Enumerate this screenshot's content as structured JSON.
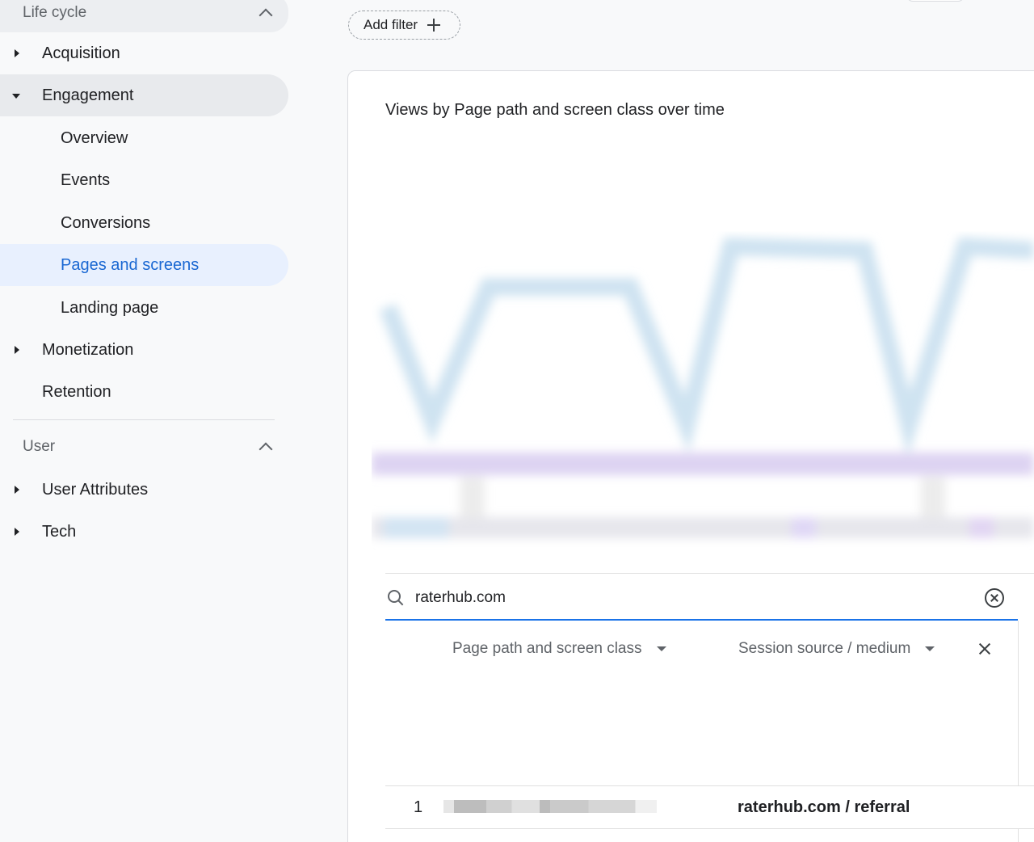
{
  "sidebar": {
    "sections": [
      {
        "title": "Life cycle"
      },
      {
        "title": "User"
      }
    ],
    "items": [
      {
        "label": "Acquisition"
      },
      {
        "label": "Engagement"
      },
      {
        "label": "Overview"
      },
      {
        "label": "Events"
      },
      {
        "label": "Conversions"
      },
      {
        "label": "Pages and screens"
      },
      {
        "label": "Landing page"
      },
      {
        "label": "Monetization"
      },
      {
        "label": "Retention"
      },
      {
        "label": "User Attributes"
      },
      {
        "label": "Tech"
      }
    ]
  },
  "toolbar": {
    "add_filter_label": "Add filter"
  },
  "card": {
    "title": "Views by Page path and screen class over time"
  },
  "search": {
    "value": "raterhub.com"
  },
  "table": {
    "headers": [
      "Page path and screen class",
      "Session source / medium"
    ],
    "rows": [
      {
        "index": "1",
        "source_medium": "raterhub.com / referral"
      }
    ]
  },
  "colors": {
    "accent": "#1a73e8",
    "selected_bg": "#e8f0fe",
    "selected_text": "#1967d2"
  }
}
